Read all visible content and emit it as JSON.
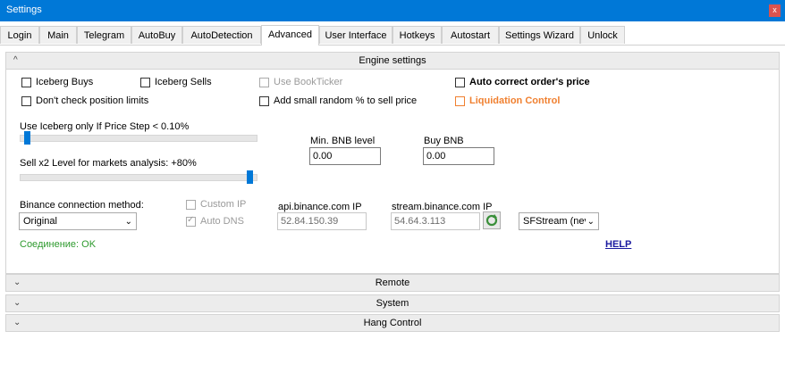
{
  "window": {
    "title": "Settings",
    "close_label": "x"
  },
  "tabs": [
    {
      "label": "Login"
    },
    {
      "label": "Main"
    },
    {
      "label": "Telegram"
    },
    {
      "label": "AutoBuy"
    },
    {
      "label": "AutoDetection"
    },
    {
      "label": "Advanced"
    },
    {
      "label": "User Interface"
    },
    {
      "label": "Hotkeys"
    },
    {
      "label": "Autostart"
    },
    {
      "label": "Settings Wizard"
    },
    {
      "label": "Unlock"
    }
  ],
  "active_tab": "Advanced",
  "engine": {
    "header": "Engine settings",
    "iceberg_buys": "Iceberg Buys",
    "iceberg_sells": "Iceberg Sells",
    "use_bookticker": "Use BookTicker",
    "auto_correct": "Auto correct order's price",
    "dont_check_limits": "Don't check position limits",
    "add_random": "Add small random % to sell price",
    "liquidation_control": "Liquidation Control",
    "iceberg_slider_label": "Use Iceberg only If Price Step < 0.10%",
    "iceberg_slider_level": 0.02,
    "sell_slider_label": "Sell x2 Level for markets analysis: +80%",
    "sell_slider_level": 0.98,
    "min_bnb_label": "Min. BNB level",
    "min_bnb_value": "0.00",
    "buy_bnb_label": "Buy BNB",
    "buy_bnb_value": "0.00",
    "connection_label": "Binance connection method:",
    "connection_value": "Original",
    "custom_ip": "Custom IP",
    "auto_dns": "Auto DNS",
    "api_ip_label": "api.binance.com IP",
    "api_ip_value": "52.84.150.39",
    "stream_ip_label": "stream.binance.com IP",
    "stream_ip_value": "54.64.3.113",
    "stream_select_value": "SFStream (nev",
    "connection_status": "Соединение:  OK",
    "help_label": "HELP"
  },
  "sections": {
    "remote": "Remote",
    "system": "System",
    "hang_control": "Hang Control"
  },
  "colors": {
    "accent": "#0078d7",
    "warning": "#f08030",
    "ok": "#2e9a2e",
    "link": "#1a1aa0"
  }
}
